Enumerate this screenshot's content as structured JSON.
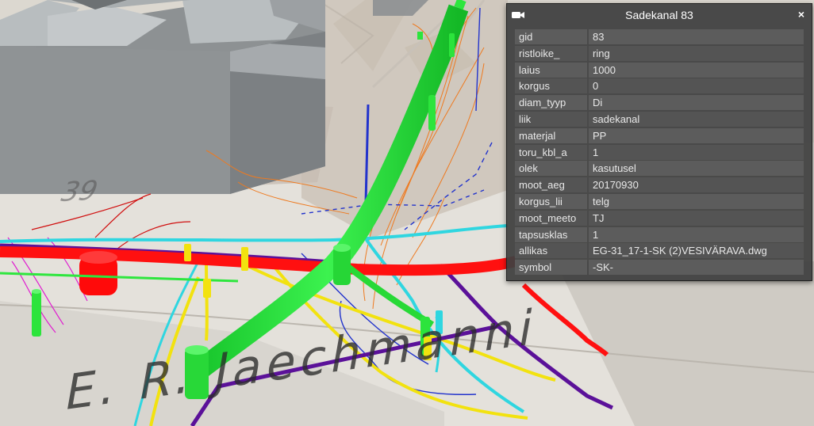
{
  "infobox": {
    "title": "Sadekanal 83",
    "close_symbol": "×",
    "icon": "camera-icon",
    "rows": [
      {
        "key": "gid",
        "value": "83"
      },
      {
        "key": "ristloike_",
        "value": "ring"
      },
      {
        "key": "laius",
        "value": "1000"
      },
      {
        "key": "korgus",
        "value": "0"
      },
      {
        "key": "diam_tyyp",
        "value": "Di"
      },
      {
        "key": "liik",
        "value": "sadekanal"
      },
      {
        "key": "materjal",
        "value": "PP"
      },
      {
        "key": "toru_kbl_a",
        "value": "1"
      },
      {
        "key": "olek",
        "value": "kasutusel"
      },
      {
        "key": "moot_aeg",
        "value": "20170930"
      },
      {
        "key": "korgus_lii",
        "value": "telg"
      },
      {
        "key": "moot_meeto",
        "value": "TJ"
      },
      {
        "key": "tapsusklas",
        "value": "1"
      },
      {
        "key": "allikas",
        "value": "EG-31_17-1-SK (2)VESIVÄRAVA.dwg"
      },
      {
        "key": "symbol",
        "value": "-SK-"
      }
    ]
  },
  "map": {
    "street_label": "E. R. Jaechmanni",
    "house_number": "39"
  },
  "colors": {
    "green_pipe": "#22e33a",
    "red_pipe": "#ff1010",
    "cyan_line": "#2fd6e0",
    "yellow_line": "#f2e20f",
    "purple_line": "#5b1199",
    "building": "#8e9294",
    "infobox_bg": "#404040"
  }
}
